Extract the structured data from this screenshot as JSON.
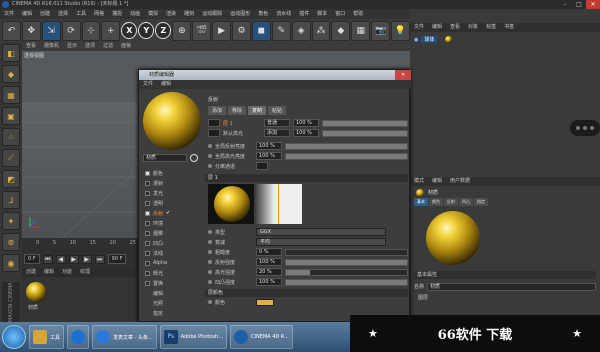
{
  "app": {
    "title": "CINEMA 4D R16.011 Studio (R16) - [未标题 1 *]"
  },
  "window_controls": {
    "min": "–",
    "max": "□",
    "close": "✕"
  },
  "menubar": [
    "文件",
    "编辑",
    "创建",
    "选择",
    "工具",
    "网格",
    "捕捉",
    "动画",
    "模拟",
    "渲染",
    "雕刻",
    "运动跟踪",
    "运动图形",
    "角色",
    "流水线",
    "插件",
    "脚本",
    "窗口",
    "帮助"
  ],
  "toolbar": {
    "items": [
      "undo-icon",
      "move-icon",
      "scale-icon",
      "rotate-icon",
      "select-icon",
      "add-icon"
    ],
    "axes": [
      "X",
      "Y",
      "Z"
    ]
  },
  "viewport": {
    "menu": [
      "查看",
      "摄像机",
      "显示",
      "选项",
      "过滤",
      "面板"
    ],
    "label": "透视视图"
  },
  "timeline": {
    "ticks": [
      "0",
      "5",
      "10",
      "15",
      "20",
      "25",
      "30",
      "35",
      "40",
      "45",
      "50",
      "55",
      "60",
      "65",
      "70",
      "75",
      "80",
      "85",
      "90"
    ],
    "frame": "0 F",
    "end_frame": "90 F"
  },
  "material_manager": {
    "tabs": [
      "创建",
      "编辑",
      "功能",
      "纹理"
    ],
    "material_name": "材质"
  },
  "maxon": "MAXON CINEMA 4D",
  "right_panel": {
    "object_tabs": [
      "文件",
      "编辑",
      "查看",
      "对象",
      "标签",
      "书签"
    ],
    "object_name": "球体",
    "attr_tabs": [
      "模式",
      "编辑",
      "用户数据"
    ],
    "material_label": "材质",
    "attr_sub_tabs": [
      "基本",
      "颜色",
      "反射",
      "凹凸",
      "指定"
    ],
    "section": "基本属性",
    "name_label": "名称",
    "name_value": "材质",
    "layer_label": "图层"
  },
  "dialog": {
    "title": "材质编辑器",
    "menu": [
      "文件",
      "编辑"
    ],
    "material_name": "材质",
    "channels": [
      {
        "name": "颜色",
        "checked": true,
        "active": false
      },
      {
        "name": "漫射",
        "checked": false,
        "active": false
      },
      {
        "name": "发光",
        "checked": false,
        "active": false
      },
      {
        "name": "透明",
        "checked": false,
        "active": false
      },
      {
        "name": "反射",
        "checked": true,
        "active": true
      },
      {
        "name": "环境",
        "checked": false,
        "active": false
      },
      {
        "name": "烟雾",
        "checked": false,
        "active": false
      },
      {
        "name": "凹凸",
        "checked": false,
        "active": false
      },
      {
        "name": "法线",
        "checked": false,
        "active": false
      },
      {
        "name": "Alpha",
        "checked": false,
        "active": false
      },
      {
        "name": "辉光",
        "checked": false,
        "active": false
      },
      {
        "name": "置换",
        "checked": false,
        "active": false
      },
      {
        "name": "编辑",
        "checked": false,
        "active": false
      },
      {
        "name": "光照",
        "checked": false,
        "active": false
      },
      {
        "name": "指定",
        "checked": false,
        "active": false
      }
    ],
    "reflect_header": "反射",
    "reflect_buttons": [
      "添加",
      "移除",
      "复制",
      "粘贴"
    ],
    "layer1": {
      "name": "层 1",
      "mode": "普通",
      "value": "100 %"
    },
    "layer_default": {
      "name": "默认高光",
      "mode": "添加",
      "value": "100 %"
    },
    "global_reflect": {
      "label": "全局反射亮度",
      "value": "100 %"
    },
    "global_spec": {
      "label": "全局高光亮度",
      "value": "100 %"
    },
    "split_channel": "分离通道",
    "layer_section": "层 1",
    "type": {
      "label": "类型",
      "value": "GGX"
    },
    "attenuation": {
      "label": "衰减",
      "value": "平均"
    },
    "roughness": {
      "label": "粗糙度",
      "value": "0 %"
    },
    "reflect_strength": {
      "label": "反射强度",
      "value": "100 %"
    },
    "spec_strength": {
      "label": "高光强度",
      "value": "20 %"
    },
    "bump_strength": {
      "label": "凹凸强度",
      "value": "100 %"
    },
    "layer_color": "层颜色",
    "color_label": "颜色"
  },
  "taskbar": {
    "items": [
      {
        "label": "工具",
        "color": "#d9a43a"
      },
      {
        "label": "",
        "color": "#1f6fd1"
      },
      {
        "label": "发表文章 - 头条...",
        "color": "#2b78d8"
      },
      {
        "label": "Adobe Photosh...",
        "color": "#1a3b6b"
      },
      {
        "label": "CINEMA 4D R...",
        "color": "#1d5fa8"
      }
    ]
  },
  "banner": {
    "text": "66软件 下载",
    "star": "★"
  },
  "colors": {
    "accent": "#ff8a4a",
    "gold": "#e0b040",
    "selection": "#1f4f7a"
  }
}
